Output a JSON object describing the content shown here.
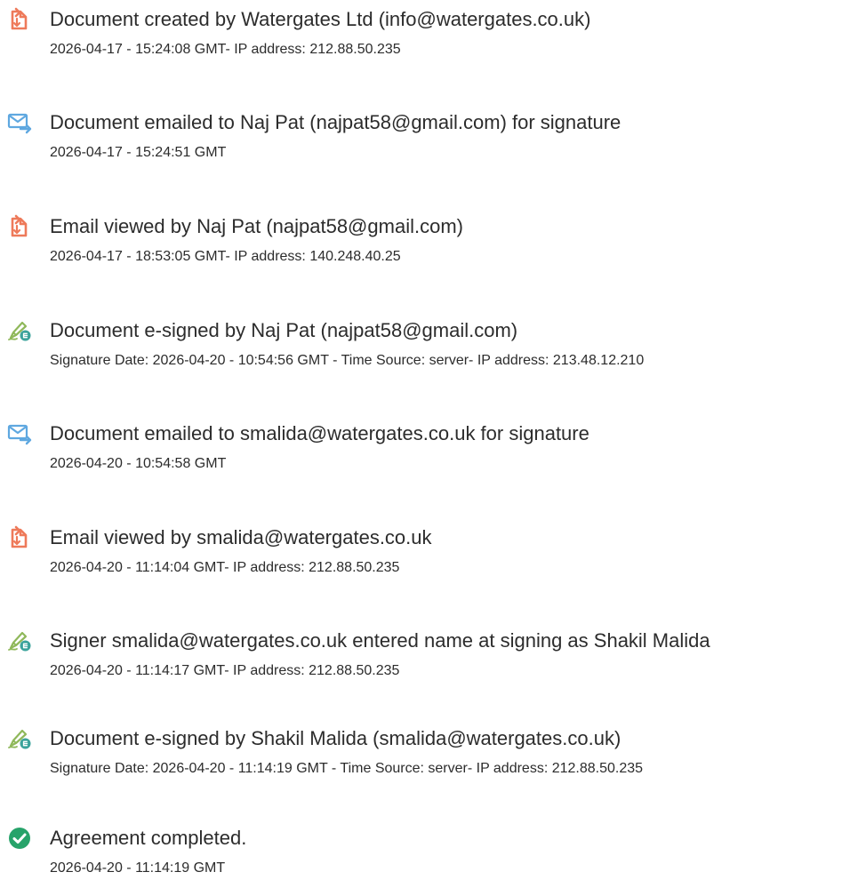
{
  "events": [
    {
      "icon": "document-icon",
      "title": "Document created by Watergates Ltd (info@watergates.co.uk)",
      "detail": "2026-04-17 - 15:24:08 GMT- IP address: 212.88.50.235"
    },
    {
      "icon": "email-sent-icon",
      "title": "Document emailed to Naj Pat (najpat58@gmail.com) for signature",
      "detail": "2026-04-17 - 15:24:51 GMT"
    },
    {
      "icon": "document-icon",
      "title": "Email viewed by Naj Pat (najpat58@gmail.com)",
      "detail": "2026-04-17 - 18:53:05 GMT- IP address: 140.248.40.25"
    },
    {
      "icon": "esign-pen-icon",
      "title": "Document e-signed by Naj Pat (najpat58@gmail.com)",
      "detail": "Signature Date: 2026-04-20 - 10:54:56 GMT - Time Source: server- IP address: 213.48.12.210"
    },
    {
      "icon": "email-sent-icon",
      "title": "Document emailed to smalida@watergates.co.uk for signature",
      "detail": "2026-04-20 - 10:54:58 GMT"
    },
    {
      "icon": "document-icon",
      "title": "Email viewed by smalida@watergates.co.uk",
      "detail": "2026-04-20 - 11:14:04 GMT- IP address: 212.88.50.235"
    },
    {
      "icon": "esign-pen-icon",
      "title": "Signer smalida@watergates.co.uk entered name at signing as Shakil Malida",
      "detail": "2026-04-20 - 11:14:17 GMT- IP address: 212.88.50.235"
    },
    {
      "icon": "esign-pen-icon",
      "title": "Document e-signed by Shakil Malida (smalida@watergates.co.uk)",
      "detail": "Signature Date: 2026-04-20 - 11:14:19 GMT - Time Source: server- IP address: 212.88.50.235"
    },
    {
      "icon": "check-circle-icon",
      "title": "Agreement completed.",
      "detail": "2026-04-20 - 11:14:19 GMT"
    }
  ],
  "colors": {
    "text": "#2c2c2c",
    "document_icon": "#ee7a5a",
    "email_icon": "#5fa8e0",
    "esign_pen": "#8fb85a",
    "esign_badge": "#3ba39b",
    "check_circle": "#27a36a"
  }
}
